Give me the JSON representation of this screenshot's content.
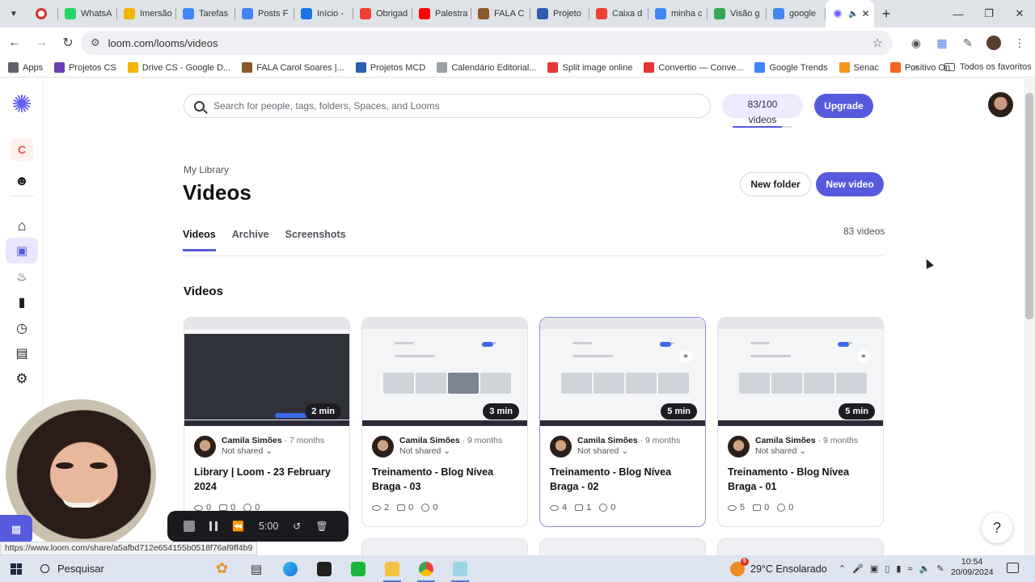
{
  "browser": {
    "tabs": [
      {
        "label": "WhatsA",
        "color": "#25d366"
      },
      {
        "label": "Imersão",
        "color": "#f4b400"
      },
      {
        "label": "Tarefas",
        "color": "#4285f4"
      },
      {
        "label": "Posts F",
        "color": "#4285f4"
      },
      {
        "label": "Início -",
        "color": "#1a73e8"
      },
      {
        "label": "Obrigad",
        "color": "#ea4335"
      },
      {
        "label": "Palestra",
        "color": "#ff0000"
      },
      {
        "label": "FALA C",
        "color": "#8a5a2b"
      },
      {
        "label": "Projeto",
        "color": "#2f5db0"
      },
      {
        "label": "Caixa d",
        "color": "#ea4335"
      },
      {
        "label": "minha c",
        "color": "#4285f4"
      },
      {
        "label": "Visão g",
        "color": "#34a853"
      },
      {
        "label": "google",
        "color": "#4285f4"
      }
    ],
    "url": "loom.com/looms/videos",
    "bookmarks": [
      {
        "label": "Apps",
        "color": "#5f6368"
      },
      {
        "label": "Projetos CS",
        "color": "#6a3fb5"
      },
      {
        "label": "Drive CS - Google D...",
        "color": "#f4b400"
      },
      {
        "label": "FALA Carol Soares |...",
        "color": "#8a5a2b"
      },
      {
        "label": "Projetos MCD",
        "color": "#2f5db0"
      },
      {
        "label": "Calendário Editorial...",
        "color": "#9aa0a6"
      },
      {
        "label": "Split image online",
        "color": "#e53935"
      },
      {
        "label": "Convertio — Conve...",
        "color": "#e53935"
      },
      {
        "label": "Google Trends",
        "color": "#4285f4"
      },
      {
        "label": "Senac",
        "color": "#f7941d"
      },
      {
        "label": "Positivo On",
        "color": "#f26522"
      }
    ],
    "bookmarks_all": "Todos os favoritos",
    "status_url": "https://www.loom.com/share/a5afbd712e654155b0518f76af9ff4b9"
  },
  "loom": {
    "search_placeholder": "Search for people, tags, folders, Spaces, and Looms",
    "quota_count": "83/100",
    "quota_unit": "videos",
    "quota_fraction": 0.83,
    "upgrade_label": "Upgrade",
    "workspace_initial": "C",
    "breadcrumb": "My Library",
    "page_title": "Videos",
    "new_folder_label": "New folder",
    "new_video_label": "New video",
    "tabs": [
      "Videos",
      "Archive",
      "Screenshots"
    ],
    "video_count": "83 videos",
    "section_title": "Videos",
    "accent": "#565add",
    "videos": [
      {
        "duration": "2 min",
        "author": "Camila Simões",
        "age": "7 months",
        "sharing": "Not shared",
        "title": "Library | Loom - 23 February 2024",
        "views": "0",
        "comments": "0",
        "reactions": "0"
      },
      {
        "duration": "3 min",
        "author": "Camila Simões",
        "age": "9 months",
        "sharing": "Not shared",
        "title": "Treinamento - Blog Nívea Braga - 03",
        "views": "2",
        "comments": "0",
        "reactions": "0"
      },
      {
        "duration": "5 min",
        "author": "Camila Simões",
        "age": "9 months",
        "sharing": "Not shared",
        "title": "Treinamento - Blog Nívea Braga - 02",
        "views": "4",
        "comments": "1",
        "reactions": "0"
      },
      {
        "duration": "5 min",
        "author": "Camila Simões",
        "age": "9 months",
        "sharing": "Not shared",
        "title": "Treinamento - Blog Nívea Braga - 01",
        "views": "5",
        "comments": "0",
        "reactions": "0"
      }
    ],
    "recorder_time": "5:00"
  },
  "taskbar": {
    "search_label": "Pesquisar",
    "weather_badge": "5",
    "weather": "29°C  Ensolarado",
    "time": "10:54",
    "date": "20/09/2024"
  }
}
